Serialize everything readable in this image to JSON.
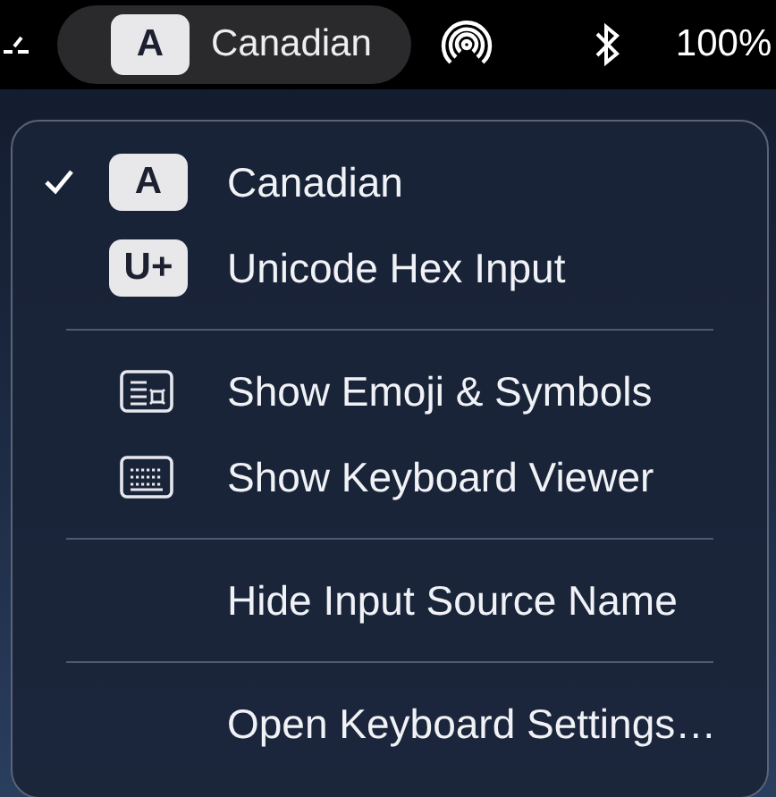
{
  "menu_bar": {
    "input_source": {
      "badge": "A",
      "label": "Canadian"
    },
    "battery": "100%"
  },
  "menu": {
    "sections": [
      {
        "items": [
          {
            "kind": "source",
            "badge": "A",
            "label": "Canadian",
            "checked": true
          },
          {
            "kind": "source",
            "badge": "U+",
            "label": "Unicode Hex Input",
            "checked": false
          }
        ]
      },
      {
        "items": [
          {
            "kind": "emoji",
            "label": "Show Emoji & Symbols"
          },
          {
            "kind": "keyboard",
            "label": "Show Keyboard Viewer"
          }
        ]
      },
      {
        "items": [
          {
            "kind": "plain",
            "label": "Hide Input Source Name"
          }
        ]
      },
      {
        "items": [
          {
            "kind": "plain",
            "label": "Open Keyboard Settings…"
          }
        ]
      }
    ]
  }
}
